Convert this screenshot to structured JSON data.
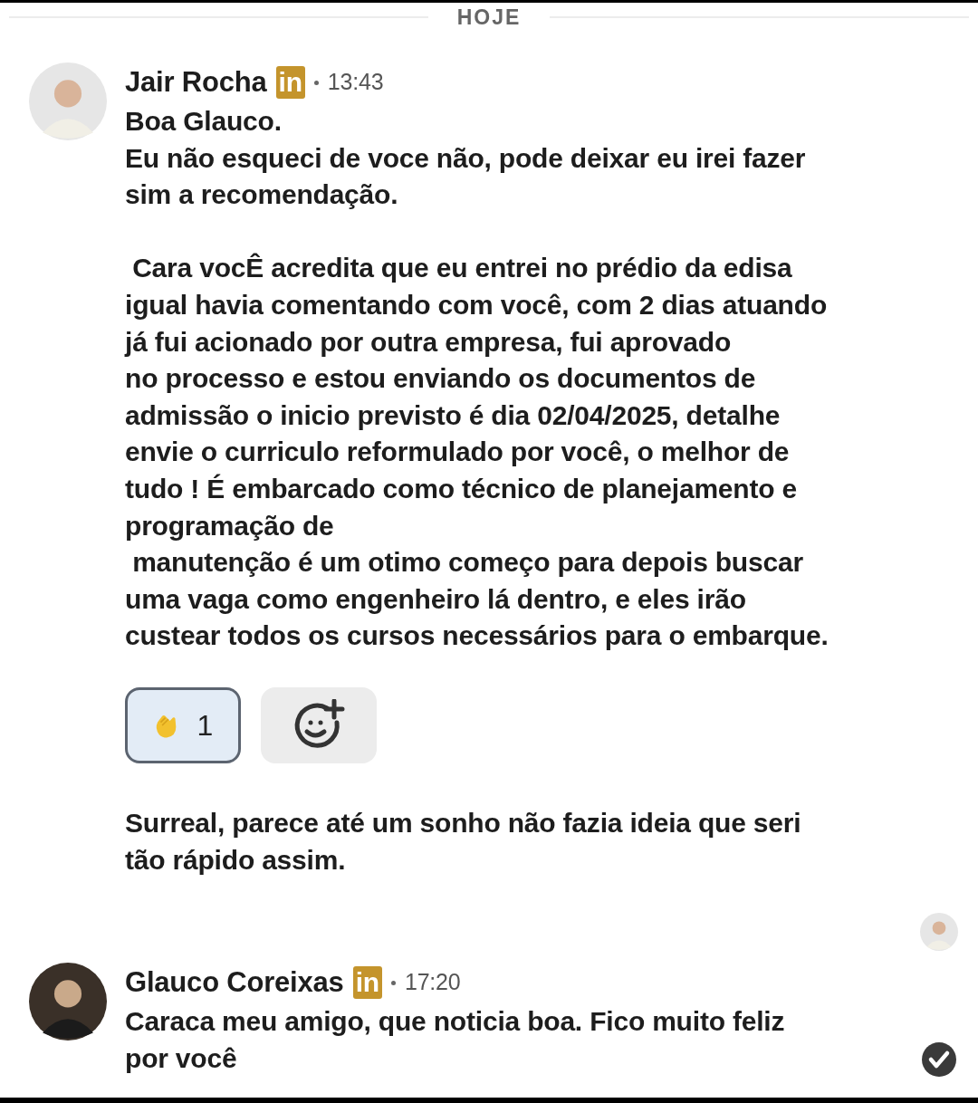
{
  "day_divider": "HOJE",
  "messages": [
    {
      "sender": "Jair Rocha",
      "time": "13:43",
      "badge": "in",
      "lines": [
        "Boa Glauco.",
        "Eu não esqueci de voce não, pode deixar eu irei fazer",
        "sim a recomendação."
      ],
      "lines_2": [
        " Cara vocÊ acredita que eu entrei no prédio da edisa",
        "igual havia comentando com você, com 2 dias atuando",
        "já fui acionado por outra empresa, fui aprovado",
        "no processo e estou enviando os documentos de",
        "admissão o inicio previsto é dia 02/04/2025, detalhe",
        "envie o curriculo reformulado por você, o melhor de",
        "tudo ! É embarcado como técnico de planejamento e",
        "programação de",
        " manutenção é um otimo começo para depois buscar",
        "uma vaga como engenheiro lá dentro, e eles irão",
        "custear todos os cursos necessários para o embarque."
      ],
      "reactions": [
        {
          "count": "1",
          "selected": true
        }
      ],
      "followup": [
        "Surreal, parece até um sonho não fazia ideia que seri",
        "tão rápido assim."
      ]
    },
    {
      "sender": "Glauco Coreixas",
      "time": "17:20",
      "badge": "in",
      "lines": [
        "Caraca meu amigo, que noticia boa. Fico muito feliz",
        "por você"
      ]
    }
  ]
}
